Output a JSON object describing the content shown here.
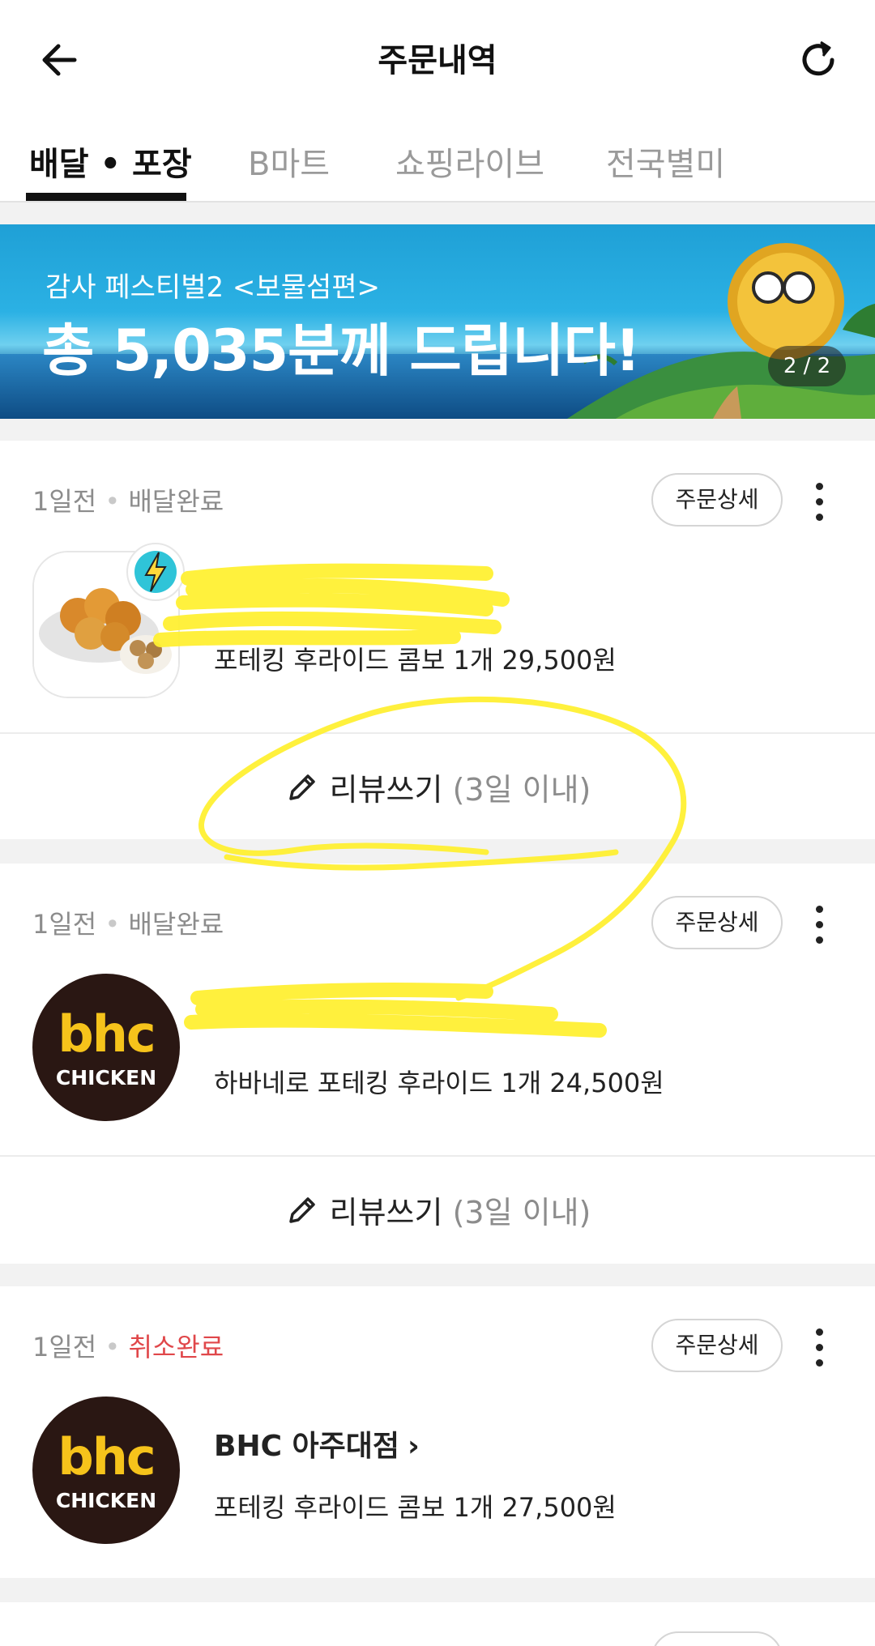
{
  "header": {
    "title": "주문내역",
    "back_icon": "arrow-left-icon",
    "refresh_icon": "refresh-icon"
  },
  "tabs": [
    {
      "label": "배달 • 포장",
      "active": true
    },
    {
      "label": "B마트",
      "active": false
    },
    {
      "label": "쇼핑라이브",
      "active": false
    },
    {
      "label": "전국별미",
      "active": false
    }
  ],
  "banner": {
    "subtitle": "감사 페스티벌2 <보물섬편>",
    "headline": "총 5,035분께 드립니다!",
    "counter": "2 / 2"
  },
  "orders": [
    {
      "time": "1일전",
      "status": "배달완료",
      "detail_label": "주문상세",
      "item": "포테킹 후라이드 콤보 1개 29,500원",
      "review_label": "리뷰쓰기",
      "review_limit": "(3일 이내)"
    },
    {
      "time": "1일전",
      "status": "배달완료",
      "detail_label": "주문상세",
      "logo_word": "bhc",
      "logo_sub": "CHICKEN",
      "item": "하바네로 포테킹 후라이드 1개 24,500원",
      "review_label": "리뷰쓰기",
      "review_limit": "(3일 이내)"
    },
    {
      "time": "1일전",
      "status": "취소완료",
      "detail_label": "주문상세",
      "logo_word": "bhc",
      "logo_sub": "CHICKEN",
      "store": "BHC 아주대점",
      "item": "포테킹 후라이드 콤보 1개 27,500원"
    }
  ],
  "colors": {
    "cancel_status": "#e0474a",
    "bhc_brown": "#2a1713",
    "bhc_yellow": "#f6c31b",
    "annotation_yellow": "#fff033"
  }
}
